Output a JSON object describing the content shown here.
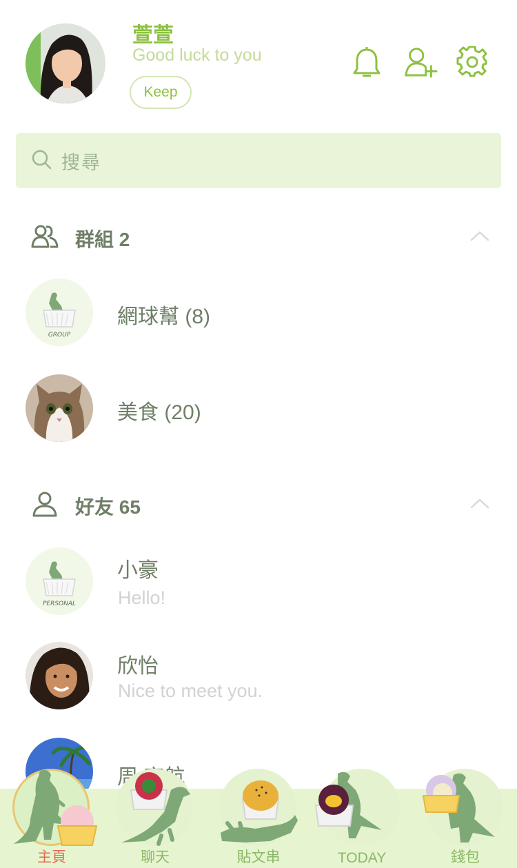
{
  "profile": {
    "name": "萱萱",
    "status": "Good luck to you",
    "keep_label": "Keep"
  },
  "header_icons": [
    "bell-icon",
    "add-friend-icon",
    "gear-icon"
  ],
  "search": {
    "placeholder": "搜尋"
  },
  "groups": {
    "title": "群組 2",
    "items": [
      {
        "name": "網球幫 (8)",
        "avatar_label": "GROUP"
      },
      {
        "name": "美食 (20)"
      }
    ]
  },
  "friends": {
    "title": "好友 65",
    "items": [
      {
        "name": "小豪",
        "status": "Hello!",
        "avatar_label": "PERSONAL"
      },
      {
        "name": "欣怡",
        "status": "Nice to meet you."
      },
      {
        "name": "周 宇航"
      }
    ]
  },
  "bottom_nav": [
    {
      "label": "主頁",
      "active": true
    },
    {
      "label": "聊天",
      "active": false
    },
    {
      "label": "貼文串",
      "active": false
    },
    {
      "label": "TODAY",
      "active": false
    },
    {
      "label": "錢包",
      "active": false
    }
  ],
  "colors": {
    "accent": "#8dc13f",
    "search_bg": "#e9f4d9",
    "nav_bg": "#e6f5cf",
    "active_nav": "#e36a4f",
    "dino": "#7fa877"
  }
}
